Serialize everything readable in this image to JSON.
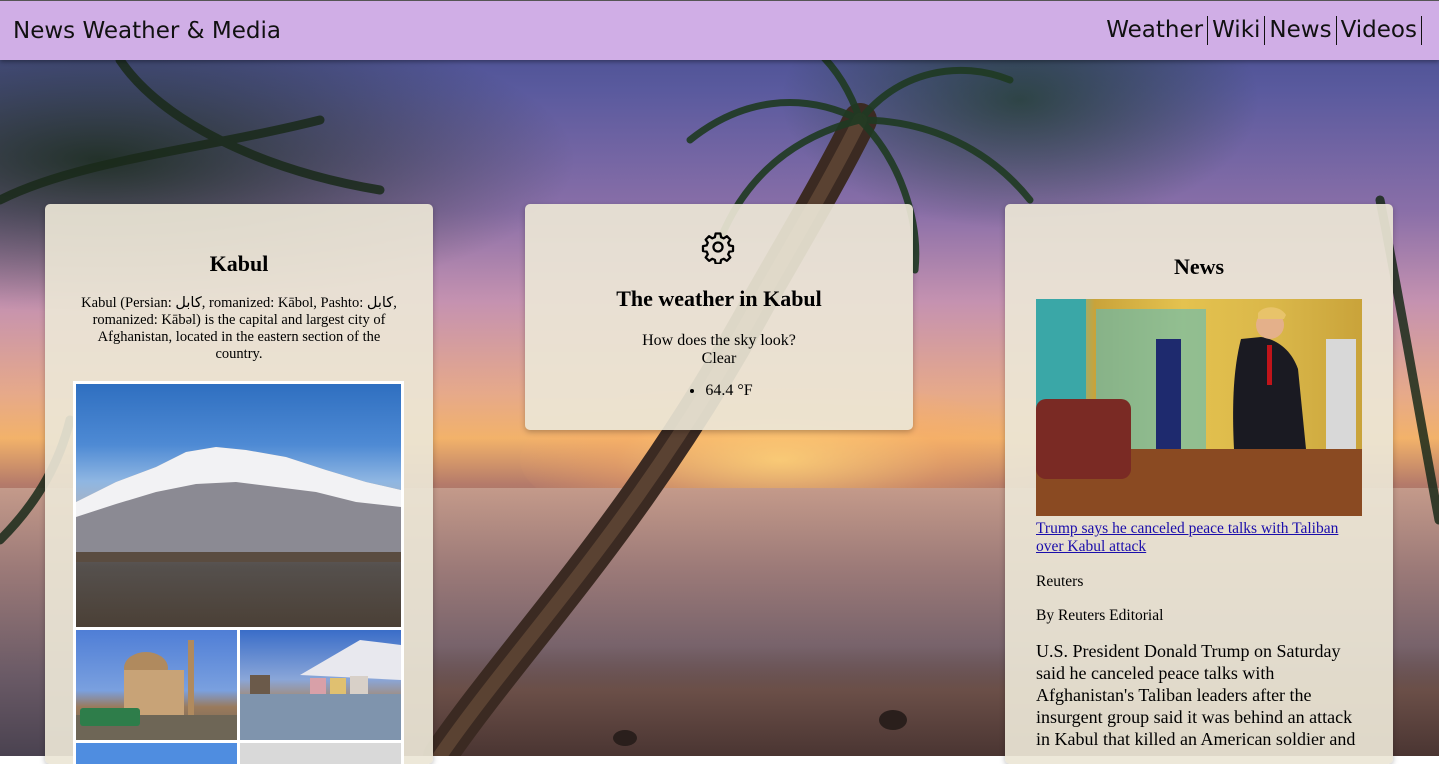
{
  "header": {
    "brand": "News Weather & Media",
    "nav": [
      "Weather",
      "Wiki",
      "News",
      "Videos"
    ]
  },
  "wiki": {
    "title": "Kabul",
    "summary": "Kabul (Persian: کابل, romanized: Kābol, Pashto: کابل, romanized: Kābəl) is the capital and largest city of Afghanistan, located in the eastern section of the country."
  },
  "weather": {
    "icon": "gear-icon",
    "title": "The weather in Kabul",
    "question": "How does the sky look?",
    "condition": "Clear",
    "temperature": "64.4 °F"
  },
  "news": {
    "title": "News",
    "headline": "Trump says he canceled peace talks with Taliban over Kabul attack",
    "source": "Reuters",
    "author": "By Reuters Editorial",
    "body": "U.S. President Donald Trump on Saturday said he canceled peace talks with Afghanistan's Taliban leaders after the insurgent group said it was behind an attack in Kabul that killed an American soldier and"
  },
  "colors": {
    "header_bg": "#d0aee6",
    "card_bg": "#ece6d6",
    "link": "#1a0dab"
  }
}
